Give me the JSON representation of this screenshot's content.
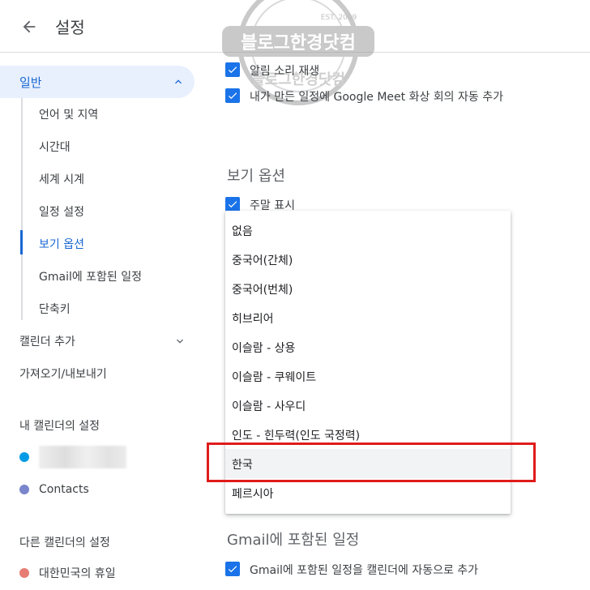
{
  "header": {
    "title": "설정"
  },
  "watermark": {
    "text": "블로그한경닷컴",
    "est": "EST. 2009"
  },
  "sidebar": {
    "general_label": "일반",
    "sub_items": [
      "언어 및 지역",
      "시간대",
      "세계 시계",
      "일정 설정",
      "보기 옵션",
      "Gmail에 포함된 일정",
      "단축키"
    ],
    "active_sub_index": 4,
    "add_calendar": "캘린더 추가",
    "import_export": "가져오기/내보내기",
    "my_calendars_heading": "내 캘린더의 설정",
    "my_calendars": [
      {
        "name": "",
        "color": "#039be5"
      },
      {
        "name": "Contacts",
        "color": "#7986cb"
      }
    ],
    "other_calendars_heading": "다른 캘린더의 설정",
    "other_calendars": [
      {
        "name": "대한민국의 휴일",
        "color": "#e67c73"
      }
    ]
  },
  "content": {
    "checkbox_alert_sound": "알림 소리 재생",
    "checkbox_meet": "내가 만든 일정에 Google Meet 화상 회의 자동 추가",
    "view_options_title": "보기 옵션",
    "checkbox_weekends": "주말 표시",
    "gmail_section_title": "Gmail에 포함된 일정",
    "checkbox_gmail": "Gmail에 포함된 일정을 캘린더에 자동으로 추가"
  },
  "dropdown": {
    "options": [
      "없음",
      "중국어(간체)",
      "중국어(번체)",
      "히브리어",
      "이슬람 - 상용",
      "이슬람 - 쿠웨이트",
      "이슬람 - 사우디",
      "인도 - 힌두력(인도 국정력)",
      "한국",
      "페르시아"
    ],
    "hovered_option": "한국"
  },
  "colors": {
    "accent": "#1a73e8",
    "nav_active_bg": "#e8f0fe",
    "highlight_box": "#e01b1b"
  }
}
